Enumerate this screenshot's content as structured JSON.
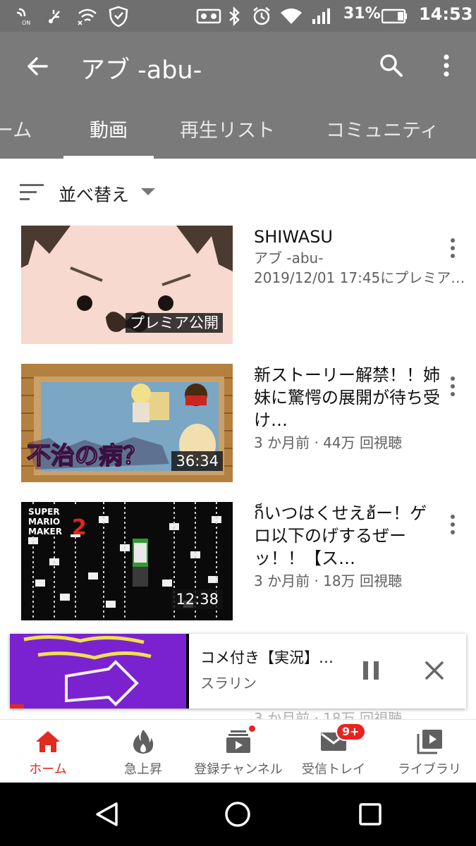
{
  "status_bar": {
    "battery_percent": "31%",
    "time": "14:53"
  },
  "app_bar": {
    "title": "アブ -abu-",
    "tabs": [
      {
        "label": "ーム",
        "active": false
      },
      {
        "label": "動画",
        "active": true
      },
      {
        "label": "再生リスト",
        "active": false
      },
      {
        "label": "コミュニティ",
        "active": false
      }
    ]
  },
  "sort": {
    "label": "並べ替え"
  },
  "videos": [
    {
      "title": "SHIWASU",
      "meta1": "アブ -abu-",
      "meta2": "2019/12/01 17:45にプレミア…",
      "badge": "プレミア公開"
    },
    {
      "title": "新ストーリー解禁！！姉妹に驚愕の展開が待ち受け…",
      "meta1": "3 か月前 · 44万 回視聴",
      "badge": "36:34",
      "thumb_text": "不治の病？"
    },
    {
      "title": "ก็いつはくせえฮ้ー！ゲロ以下のげするぜーッ！！【ス…",
      "meta1": "3 か月前 · 18万 回視聴",
      "badge": "12:38",
      "thumb_text": "SUPER MARIO MAKER 2"
    }
  ],
  "partial_row_text": "3 か月前 · 18万 回視聴",
  "mini_player": {
    "title": "コメ付き【実況】…",
    "channel": "スラリン"
  },
  "bottom_nav": {
    "items": [
      {
        "label": "ホーム",
        "icon": "home-icon",
        "active": true
      },
      {
        "label": "急上昇",
        "icon": "flame-icon",
        "active": false
      },
      {
        "label": "登録チャンネル",
        "icon": "subscriptions-icon",
        "active": false
      },
      {
        "label": "受信トレイ",
        "icon": "inbox-icon",
        "active": false,
        "badge": "9+"
      },
      {
        "label": "ライブラリ",
        "icon": "library-icon",
        "active": false
      }
    ]
  },
  "colors": {
    "accent": "#e02b20",
    "app_bar": "#7a7a7a",
    "status_bar": "#6f6f6f"
  }
}
